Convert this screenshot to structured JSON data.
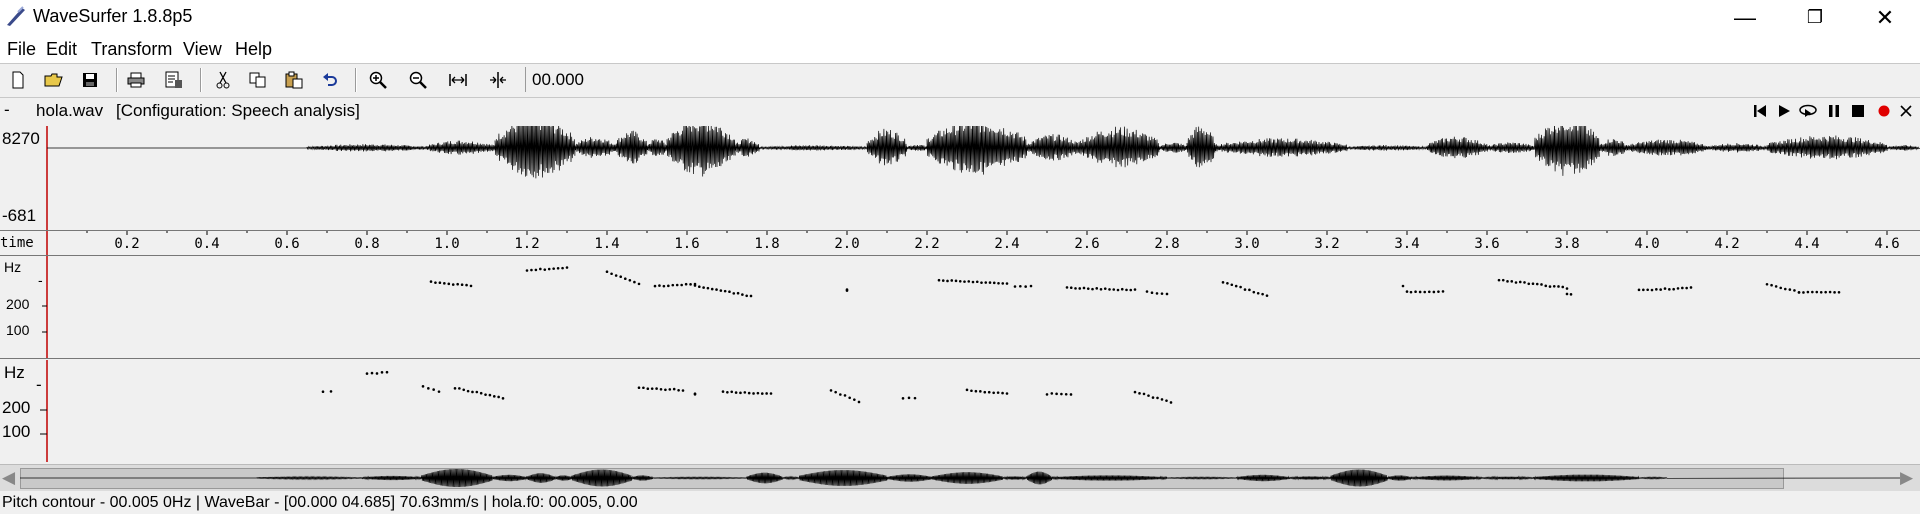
{
  "window": {
    "title": "WaveSurfer 1.8.8p5",
    "controls": {
      "minimize": "—",
      "restore": "❐",
      "close": "✕"
    }
  },
  "menu": [
    "File",
    "Edit",
    "Transform",
    "View",
    "Help"
  ],
  "toolbar": {
    "icons": [
      "new-file-icon",
      "open-folder-icon",
      "save-icon",
      "print-icon",
      "properties-icon",
      "cut-icon",
      "copy-icon",
      "paste-icon",
      "undo-icon",
      "zoom-in-icon",
      "zoom-out-icon",
      "zoom-fit-icon",
      "zoom-selection-icon"
    ],
    "time_value": "00.000"
  },
  "sound": {
    "dash": "-",
    "filename": "hola.wav",
    "configuration": "[Configuration: Speech analysis]",
    "playback_icons": [
      "skip-to-start-icon",
      "play-icon",
      "play-loop-icon",
      "pause-icon",
      "stop-icon",
      "record-icon",
      "close-icon"
    ]
  },
  "waveform": {
    "max_label": "8270",
    "min_label": "-681"
  },
  "time_axis": {
    "label": "time",
    "ticks": [
      "0.2",
      "0.4",
      "0.6",
      "0.8",
      "1.0",
      "1.2",
      "1.4",
      "1.6",
      "1.8",
      "2.0",
      "2.2",
      "2.4",
      "2.6",
      "2.8",
      "3.0",
      "3.2",
      "3.4",
      "3.6",
      "3.8",
      "4.0",
      "4.2",
      "4.4",
      "4.6"
    ]
  },
  "pitch_pane_1": {
    "unit": "Hz",
    "tick_top": "-",
    "tick_200": "200",
    "tick_100": "100"
  },
  "pitch_pane_2": {
    "unit": "Hz",
    "tick_top": "-",
    "tick_200": "200",
    "tick_100": "100"
  },
  "wavebar": {
    "left_arrow": "◀",
    "right_arrow": "▶"
  },
  "status": {
    "text": "Pitch contour - 00.005 0Hz  | WaveBar - [00.000 04.685] 70.63mm/s | hola.f0: 00.005, 0.00"
  },
  "colors": {
    "cursor": "#c00000",
    "record": "#e00000",
    "signal": "#000000",
    "background": "#f0f0f0"
  }
}
